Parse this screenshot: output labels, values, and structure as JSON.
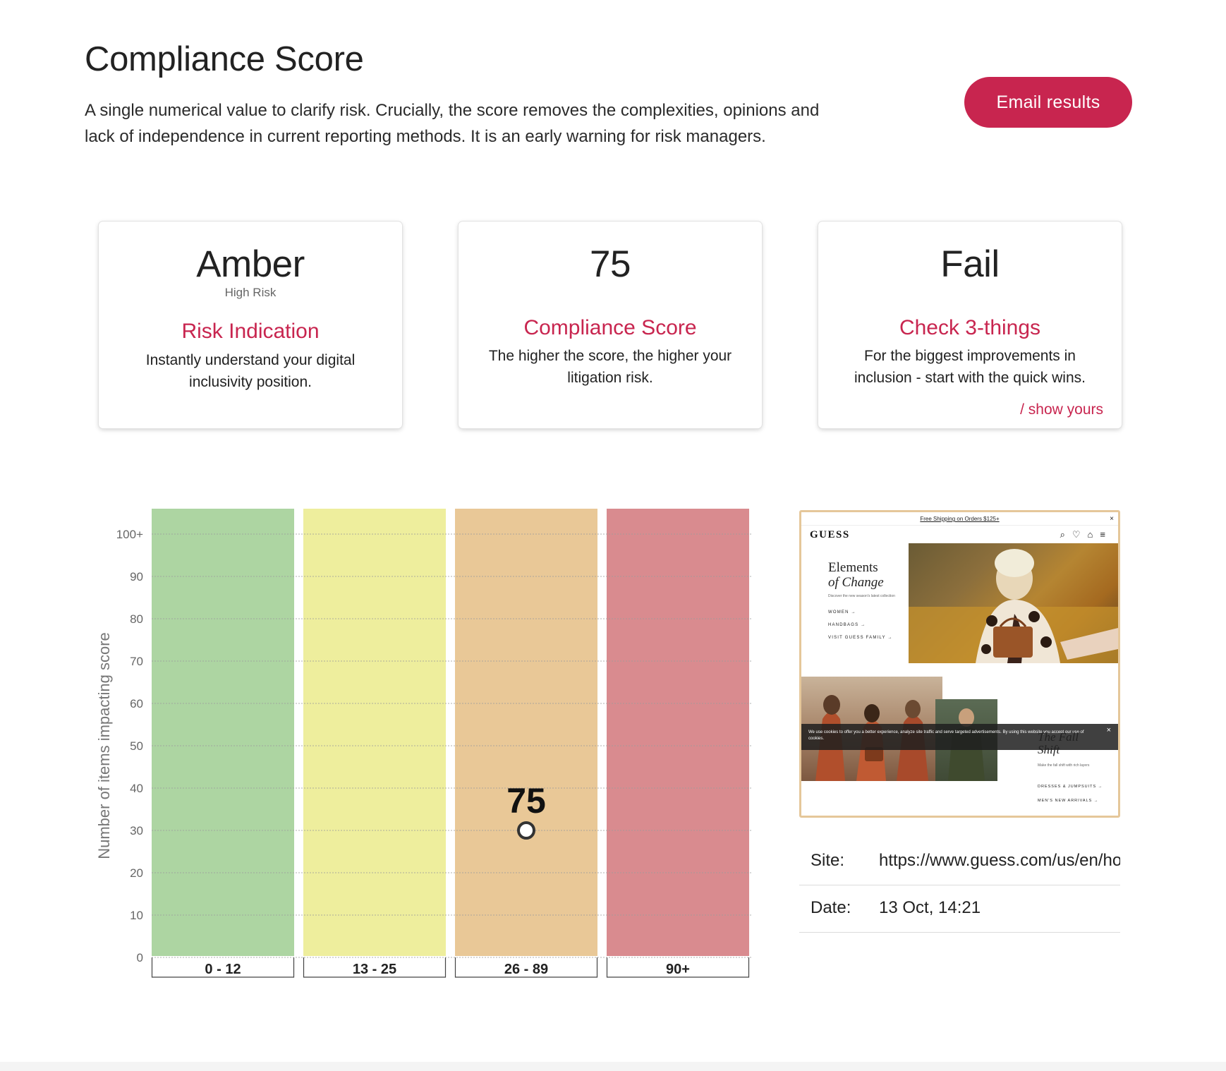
{
  "header": {
    "title": "Compliance Score",
    "intro": "A single numerical value to clarify risk. Crucially, the score removes the complexities, opinions and lack of independence in current reporting methods. It is an early warning for risk managers.",
    "email_label": "Email results",
    "accent_color": "#c8254f"
  },
  "cards": {
    "risk": {
      "big": "Amber",
      "sub": "High Risk",
      "heading": "Risk Indication",
      "desc": "Instantly understand your digital inclusivity position."
    },
    "score": {
      "big": "75",
      "heading": "Compliance Score",
      "desc": "The higher the score, the higher your litigation risk."
    },
    "check": {
      "big": "Fail",
      "heading": "Check 3-things",
      "desc": "For the biggest improvements in inclusion - start with the quick wins.",
      "link": "/ show yours"
    }
  },
  "chart_data": {
    "type": "bar",
    "categories": [
      "0 - 12",
      "13 - 25",
      "26 - 89",
      "90+"
    ],
    "band_colors": [
      "#add5a2",
      "#eeee9d",
      "#e9c897",
      "#d98b8f"
    ],
    "ylabel": "Number of items impacting score",
    "y_ticks": [
      "0",
      "10",
      "20",
      "30",
      "40",
      "50",
      "60",
      "70",
      "80",
      "90",
      "100+"
    ],
    "ylim": [
      0,
      100
    ],
    "grid": true,
    "marker": {
      "category": "26 - 89",
      "y": 30,
      "label": "75"
    }
  },
  "screenshot": {
    "promo": "Free Shipping on Orders $125+",
    "close": "×",
    "logo": "GUESS",
    "icons": [
      "search-icon",
      "heart-icon",
      "bag-icon",
      "menu-icon"
    ],
    "icon_glyphs": "⌕♡⌂≡",
    "hero_title_1": "Elements",
    "hero_title_2": "of Change",
    "hero_blurb": "Discover the new season's latest collection",
    "hero_links": [
      "WOMEN →",
      "HANDBAGS →",
      "VISIT GUESS FAMILY →"
    ],
    "cookie_text": "We use cookies to offer you a better experience, analyze site traffic and serve targeted advertisements. By using this website you accept our use of cookies.",
    "cookie_close": "×",
    "fall_title_1": "The Fall",
    "fall_title_2": "Shift",
    "fall_blurb": "Make the fall shift with rich layers",
    "fall_links": [
      "DRESSES & JUMPSUITS →",
      "MEN'S NEW ARRIVALS →"
    ]
  },
  "meta": {
    "site_label": "Site:",
    "site_value": "https://www.guess.com/us/en/home",
    "date_label": "Date:",
    "date_value": "13 Oct, 14:21"
  }
}
